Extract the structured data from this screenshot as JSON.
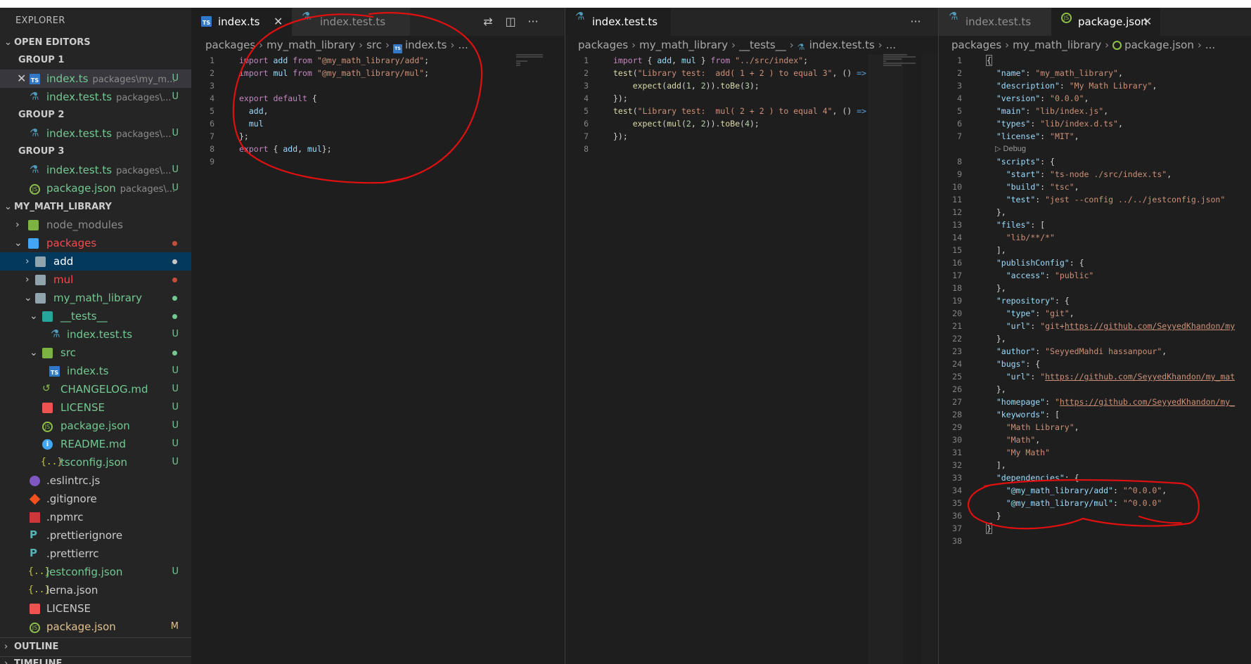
{
  "explorer": {
    "title": "EXPLORER",
    "open_editors": {
      "title": "OPEN EDITORS",
      "groups": [
        {
          "label": "GROUP 1",
          "items": [
            {
              "name": "index.ts",
              "path": "packages\\my_m...",
              "badge": "U"
            },
            {
              "name": "index.test.ts",
              "path": "packages\\...",
              "badge": "U"
            }
          ]
        },
        {
          "label": "GROUP 2",
          "items": [
            {
              "name": "index.test.ts",
              "path": "packages\\...",
              "badge": "U"
            }
          ]
        },
        {
          "label": "GROUP 3",
          "items": [
            {
              "name": "index.test.ts",
              "path": "packages\\...",
              "badge": "U"
            },
            {
              "name": "package.json",
              "path": "packages\\...",
              "badge": "U"
            }
          ]
        }
      ]
    },
    "project": {
      "title": "MY_MATH_LIBRARY",
      "tree": [
        {
          "name": "node_modules"
        },
        {
          "name": "packages"
        },
        {
          "name": "add"
        },
        {
          "name": "mul"
        },
        {
          "name": "my_math_library"
        },
        {
          "name": "__tests__"
        },
        {
          "name": "index.test.ts",
          "badge": "U"
        },
        {
          "name": "src"
        },
        {
          "name": "index.ts",
          "badge": "U"
        },
        {
          "name": "CHANGELOG.md",
          "badge": "U"
        },
        {
          "name": "LICENSE",
          "badge": "U"
        },
        {
          "name": "package.json",
          "badge": "U"
        },
        {
          "name": "README.md",
          "badge": "U"
        },
        {
          "name": "tsconfig.json",
          "badge": "U"
        },
        {
          "name": ".eslintrc.js"
        },
        {
          "name": ".gitignore"
        },
        {
          "name": ".npmrc"
        },
        {
          "name": ".prettierignore"
        },
        {
          "name": ".prettierrc"
        },
        {
          "name": "jestconfig.json",
          "badge": "U"
        },
        {
          "name": "lerna.json"
        },
        {
          "name": "LICENSE"
        },
        {
          "name": "package.json",
          "badge": "M"
        }
      ]
    },
    "outline": "OUTLINE",
    "timeline": "TIMELINE"
  },
  "pane1": {
    "tabs": [
      {
        "label": "index.ts"
      },
      {
        "label": "index.test.ts"
      }
    ],
    "breadcrumb": [
      "packages",
      "my_math_library",
      "src",
      "index.ts",
      "..."
    ],
    "lines": [
      "import add from \"@my_math_library/add\";",
      "import mul from \"@my_math_library/mul\";",
      "",
      "export default {",
      "  add,",
      "  mul",
      "};",
      "export { add, mul};",
      ""
    ]
  },
  "pane2": {
    "tabs": [
      {
        "label": "index.test.ts"
      }
    ],
    "breadcrumb": [
      "packages",
      "my_math_library",
      "__tests__",
      "index.test.ts",
      "..."
    ],
    "lines": [
      "import { add, mul } from \"../src/index\";",
      "test(\"Library test:  add( 1 + 2 ) to equal 3\", () =>",
      "    expect(add(1, 2)).toBe(3);",
      "});",
      "test(\"Library test:  mul( 2 + 2 ) to equal 4\", () =>",
      "    expect(mul(2, 2)).toBe(4);",
      "});",
      ""
    ]
  },
  "pane3": {
    "tabs": [
      {
        "label": "index.test.ts"
      },
      {
        "label": "package.json"
      }
    ],
    "breadcrumb": [
      "packages",
      "my_math_library",
      "package.json",
      "..."
    ],
    "codelens": "Debug",
    "lines": [
      "{",
      "  \"name\": \"my_math_library\",",
      "  \"description\": \"My Math Library\",",
      "  \"version\": \"0.0.0\",",
      "  \"main\": \"lib/index.js\",",
      "  \"types\": \"lib/index.d.ts\",",
      "  \"license\": \"MIT\",",
      "  \"scripts\": {",
      "    \"start\": \"ts-node ./src/index.ts\",",
      "    \"build\": \"tsc\",",
      "    \"test\": \"jest --config ../../jestconfig.json\"",
      "  },",
      "  \"files\": [",
      "    \"lib/**/*\"",
      "  ],",
      "  \"publishConfig\": {",
      "    \"access\": \"public\"",
      "  },",
      "  \"repository\": {",
      "    \"type\": \"git\",",
      "    \"url\": \"git+https://github.com/SeyyedKhandon/my",
      "  },",
      "  \"author\": \"SeyyedMahdi hassanpour\",",
      "  \"bugs\": {",
      "    \"url\": \"https://github.com/SeyyedKhandon/my_mat",
      "  },",
      "  \"homepage\": \"https://github.com/SeyyedKhandon/my_",
      "  \"keywords\": [",
      "    \"Math Library\",",
      "    \"Math\",",
      "    \"My Math\"",
      "  ],",
      "  \"dependencies\": {",
      "    \"@my_math_library/add\": \"^0.0.0\",",
      "    \"@my_math_library/mul\": \"^0.0.0\"",
      "  }",
      "}",
      ""
    ]
  },
  "colors": {
    "editor_bg": "#1e1e1e",
    "sidebar_bg": "#252526",
    "selection": "#04395e",
    "untracked_green": "#73c991",
    "error_red": "#f14c4c",
    "annotation_red": "#e01010"
  }
}
